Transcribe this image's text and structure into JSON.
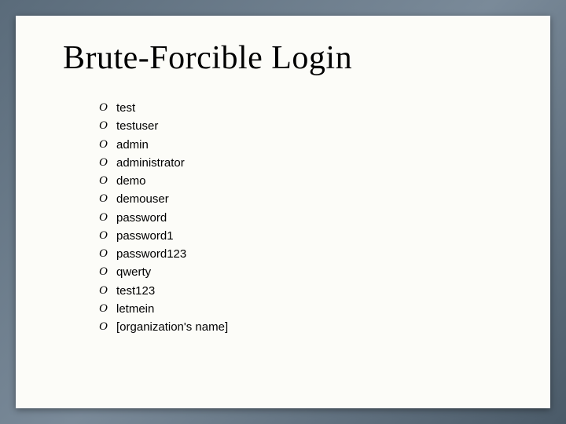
{
  "title": "Brute-Forcible Login",
  "items": [
    "test",
    "testuser",
    "admin",
    "administrator",
    "demo",
    "demouser",
    "password",
    "password1",
    "password123",
    "qwerty",
    "test123",
    "letmein",
    "[organization's name]"
  ]
}
